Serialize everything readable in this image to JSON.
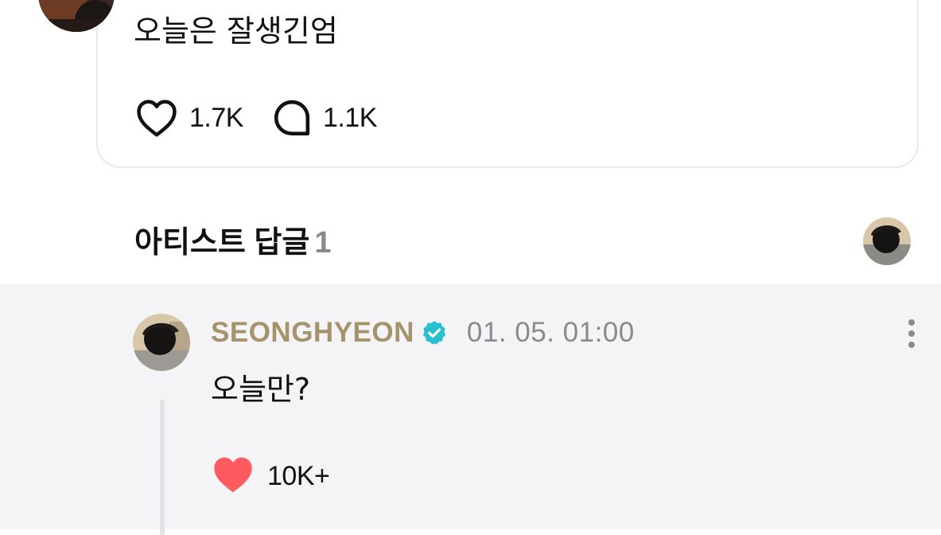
{
  "post": {
    "text": "오늘은 잘생긴엄",
    "likes": "1.7K",
    "comments": "1.1K",
    "like_icon": "heart-outline-icon",
    "comment_icon": "comment-bubble-icon"
  },
  "artist_reply_header": {
    "title": "아티스트 답글",
    "count": "1"
  },
  "reply": {
    "author": "SEONGHYEON",
    "verified_icon": "verified-badge-icon",
    "date": "01. 05. 01:00",
    "text": "오늘만?",
    "likes": "10K+",
    "like_icon": "heart-filled-icon",
    "more_icon": "more-vertical-icon"
  },
  "colors": {
    "author_name": "#a4936b",
    "verified_badge": "#27c0cf",
    "liked_heart": "#ff5a5f",
    "meta_gray": "#8a8a8e",
    "reply_background": "#f4f4f6"
  }
}
